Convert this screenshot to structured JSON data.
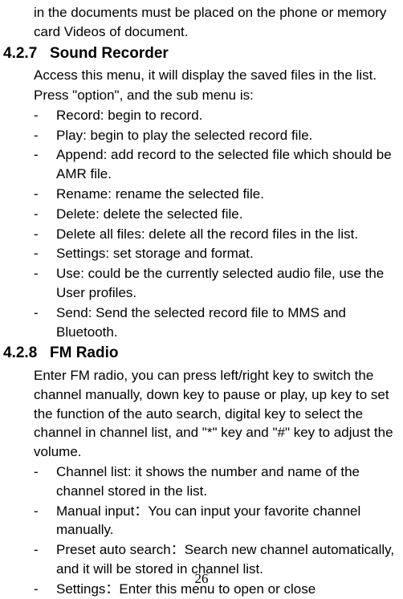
{
  "intro_text": "in the documents must be placed on the phone or memory card Videos of document.",
  "section_4_2_7": {
    "number": "4.2.7",
    "title": "Sound Recorder",
    "body1": "Access this menu, it will display the saved files in the list.",
    "body2": "Press \"option\", and the sub menu is:",
    "items": [
      "Record: begin to record.",
      "Play: begin to play the selected record file.",
      "Append: add record to the selected file which should be AMR file.",
      "Rename: rename the selected file.",
      "Delete: delete the selected file.",
      "Delete all files: delete all the record files in the list.",
      "Settings: set storage and format.",
      "Use: could be the currently selected audio file, use the User profiles.",
      "Send: Send the selected record file to MMS and Bluetooth."
    ]
  },
  "section_4_2_8": {
    "number": "4.2.8",
    "title": "FM Radio",
    "body1": "Enter FM radio, you can press left/right key to switch the channel manually, down key to pause or play, up key to set the function of the auto search, digital key to select the channel in channel list, and \"*\" key and \"#\" key to adjust the volume.",
    "items": [
      "Channel list: it shows the number and name of the channel stored in the list.",
      "Manual input：You can input your favorite channel manually.",
      "Preset auto search：Search new channel automatically, and it will be stored in channel list.",
      "Settings：Enter this menu to open or close"
    ]
  },
  "bullet": "-",
  "page_number": "26"
}
